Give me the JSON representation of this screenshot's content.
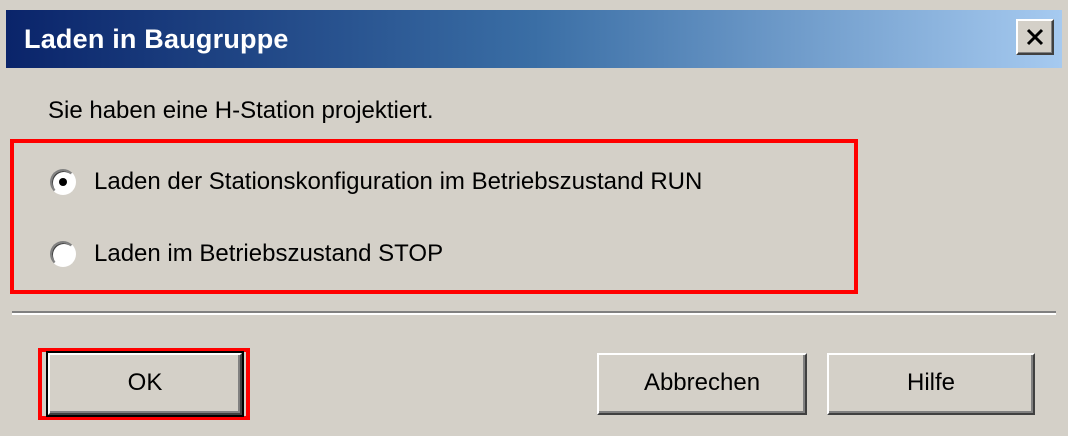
{
  "window": {
    "title": "Laden in Baugruppe",
    "close_symbol": "X"
  },
  "message": "Sie haben eine H-Station projektiert.",
  "options": [
    {
      "label": "Laden der Stationskonfiguration im Betriebszustand RUN",
      "selected": true
    },
    {
      "label": "Laden im Betriebszustand STOP",
      "selected": false
    }
  ],
  "buttons": {
    "ok": "OK",
    "cancel": "Abbrechen",
    "help": "Hilfe"
  },
  "highlight_color": "#ff0000"
}
